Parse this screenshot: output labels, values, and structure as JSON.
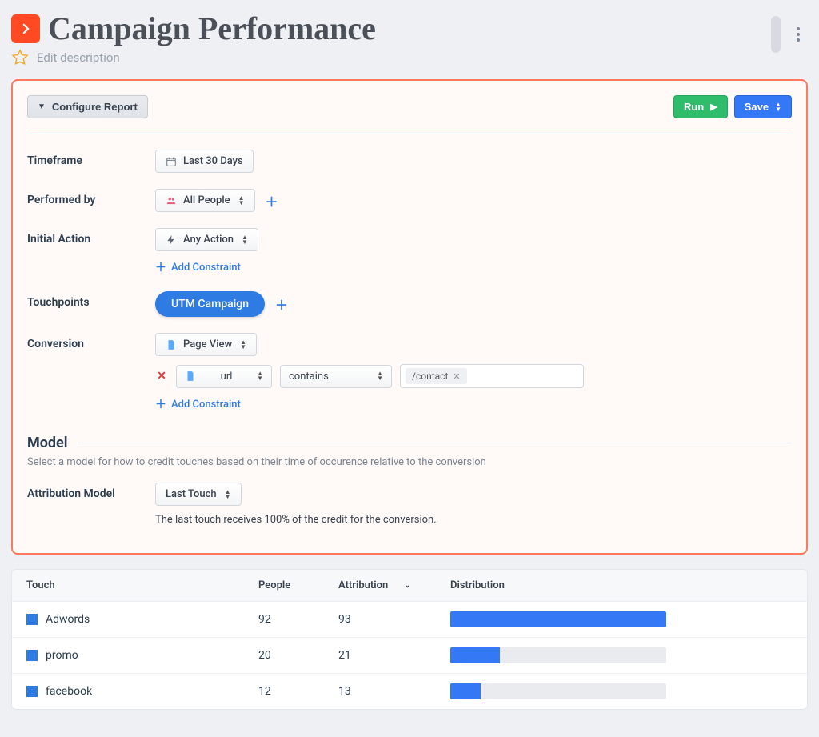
{
  "header": {
    "title": "Campaign Performance",
    "edit_description": "Edit description"
  },
  "config": {
    "configure_label": "Configure Report",
    "run_label": "Run",
    "save_label": "Save",
    "timeframe": {
      "label": "Timeframe",
      "value": "Last 30 Days"
    },
    "performed_by": {
      "label": "Performed by",
      "value": "All People"
    },
    "initial_action": {
      "label": "Initial Action",
      "value": "Any Action",
      "add_constraint": "Add Constraint"
    },
    "touchpoints": {
      "label": "Touchpoints",
      "chip": "UTM Campaign"
    },
    "conversion": {
      "label": "Conversion",
      "value": "Page View",
      "constraint": {
        "field": "url",
        "operator": "contains",
        "value": "/contact"
      },
      "add_constraint": "Add Constraint"
    },
    "model": {
      "section_title": "Model",
      "section_sub": "Select a model for how to credit touches based on their time of occurence relative to the conversion",
      "label": "Attribution Model",
      "value": "Last Touch",
      "description": "The last touch receives 100% of the credit for the conversion."
    }
  },
  "results": {
    "columns": {
      "touch": "Touch",
      "people": "People",
      "attribution": "Attribution",
      "distribution": "Distribution"
    },
    "max_attribution": 93,
    "rows": [
      {
        "touch": "Adwords",
        "people": 92,
        "attribution": 93
      },
      {
        "touch": "promo",
        "people": 20,
        "attribution": 21
      },
      {
        "touch": "facebook",
        "people": 12,
        "attribution": 13
      }
    ]
  }
}
